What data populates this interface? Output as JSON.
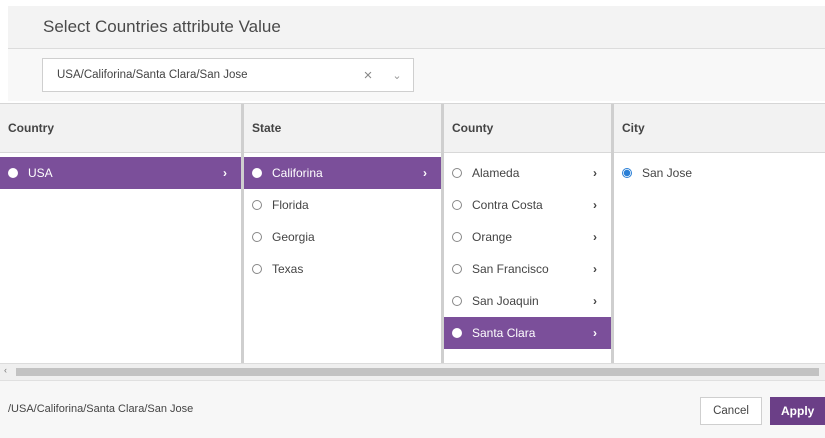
{
  "dialog": {
    "title": "Select Countries attribute Value"
  },
  "picker": {
    "value": "USA/Califorina/Santa Clara/San Jose",
    "clear_icon": "×",
    "arrow_icon": "⌄"
  },
  "columns": {
    "country": {
      "header": "Country",
      "items": [
        {
          "label": "USA",
          "selected": true,
          "chevron": "›"
        }
      ]
    },
    "state": {
      "header": "State",
      "items": [
        {
          "label": "Califorina",
          "selected": true,
          "chevron": "›"
        },
        {
          "label": "Florida"
        },
        {
          "label": "Georgia"
        },
        {
          "label": "Texas"
        }
      ]
    },
    "county": {
      "header": "County",
      "items": [
        {
          "label": "Alameda",
          "chevron": "›"
        },
        {
          "label": "Contra Costa",
          "chevron": "›"
        },
        {
          "label": "Orange",
          "chevron": "›"
        },
        {
          "label": "San Francisco",
          "chevron": "›"
        },
        {
          "label": "San Joaquin",
          "chevron": "›"
        },
        {
          "label": "Santa Clara",
          "selected": true,
          "chevron": "›"
        }
      ]
    },
    "city": {
      "header": "City",
      "items": [
        {
          "label": "San Jose",
          "checked": true
        }
      ]
    }
  },
  "scrollbar": {
    "left_arrow": "‹"
  },
  "footer": {
    "path": "/USA/Califorina/Santa Clara/San Jose",
    "cancel_label": "Cancel",
    "apply_label": "Apply"
  },
  "colors": {
    "selected_bg": "#7b4f9a",
    "apply_bg": "#6b3f87",
    "radio_checked": "#2a7fd6"
  }
}
